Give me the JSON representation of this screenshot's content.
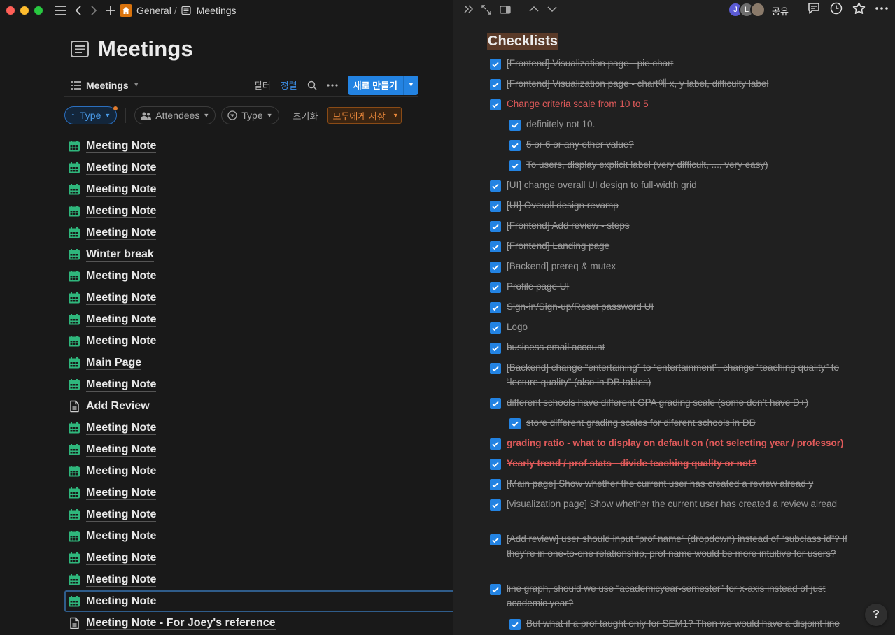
{
  "breadcrumb": {
    "workspace": "General",
    "separator": "/",
    "page": "Meetings"
  },
  "page": {
    "title": "Meetings"
  },
  "viewbar": {
    "view_name": "Meetings",
    "filter_label": "필터",
    "sort_label": "정렬",
    "new_label": "새로 만들기"
  },
  "filterbar": {
    "sort_chip": "Type",
    "attendees_chip": "Attendees",
    "type_chip": "Type",
    "reset_label": "초기화",
    "save_all_label": "모두에게 저장"
  },
  "rows": [
    {
      "title": "Meeting Note",
      "icon": "calendar-icon"
    },
    {
      "title": "Meeting Note",
      "icon": "calendar-icon"
    },
    {
      "title": "Meeting Note",
      "icon": "calendar-icon"
    },
    {
      "title": "Meeting Note",
      "icon": "calendar-icon"
    },
    {
      "title": "Meeting Note",
      "icon": "calendar-icon"
    },
    {
      "title": "Winter break",
      "icon": "calendar-icon"
    },
    {
      "title": "Meeting Note",
      "icon": "calendar-icon"
    },
    {
      "title": "Meeting Note",
      "icon": "calendar-icon"
    },
    {
      "title": "Meeting Note",
      "icon": "calendar-icon"
    },
    {
      "title": "Meeting Note",
      "icon": "calendar-icon"
    },
    {
      "title": "Main Page",
      "icon": "calendar-icon"
    },
    {
      "title": "Meeting Note",
      "icon": "calendar-icon"
    },
    {
      "title": "Add Review",
      "icon": "page-icon"
    },
    {
      "title": "Meeting Note",
      "icon": "calendar-icon"
    },
    {
      "title": "Meeting Note",
      "icon": "calendar-icon"
    },
    {
      "title": "Meeting Note",
      "icon": "calendar-icon"
    },
    {
      "title": "Meeting Note",
      "icon": "calendar-icon"
    },
    {
      "title": "Meeting Note",
      "icon": "calendar-icon"
    },
    {
      "title": "Meeting Note",
      "icon": "calendar-icon"
    },
    {
      "title": "Meeting Note",
      "icon": "calendar-icon"
    },
    {
      "title": "Meeting Note",
      "icon": "calendar-icon"
    },
    {
      "title": "Meeting Note",
      "icon": "calendar-icon",
      "selected": true
    },
    {
      "title": "Meeting Note - For Joey's reference",
      "icon": "page-icon"
    }
  ],
  "right_panel": {
    "avatars": [
      "J",
      "L",
      ""
    ],
    "share_label": "공유",
    "section_title": "Checklists",
    "help_label": "?",
    "checklist": [
      {
        "text": "[Frontend] Visualization page - pie chart",
        "indent": 0,
        "lines": 1
      },
      {
        "text": "[Frontend] Visualization page - chart에 x, y label,  difficulty label",
        "indent": 0,
        "lines": 1
      },
      {
        "text": "Change criteria scale from 10 to 5",
        "indent": 0,
        "lines": 1,
        "style": "red"
      },
      {
        "text": "definitely not 10.",
        "indent": 1,
        "lines": 1
      },
      {
        "text": "5 or 6 or any other value?",
        "indent": 1,
        "lines": 1
      },
      {
        "text": "To users, display explicit label (very difficult, ..., very easy)",
        "indent": 1,
        "lines": 1
      },
      {
        "text": "[UI] change overall UI design to full-width grid",
        "indent": 0,
        "lines": 1
      },
      {
        "text": "[UI] Overall design revamp",
        "indent": 0,
        "lines": 1
      },
      {
        "text": "[Frontend] Add review - steps",
        "indent": 0,
        "lines": 1
      },
      {
        "text": "[Frontend] Landing page",
        "indent": 0,
        "lines": 1
      },
      {
        "text": "[Backend] prereq & mutex",
        "indent": 0,
        "lines": 1
      },
      {
        "text": "Profile page UI",
        "indent": 0,
        "lines": 1
      },
      {
        "text": "Sign-in/Sign-up/Reset password UI",
        "indent": 0,
        "lines": 1
      },
      {
        "text": "Logo",
        "indent": 0,
        "lines": 1
      },
      {
        "text": "business email account",
        "indent": 0,
        "lines": 1
      },
      {
        "text": "[Backend] change “entertaining” to “entertainment”, change “teaching quality” to “lecture quality” (also in DB tables)",
        "indent": 0,
        "lines": 2
      },
      {
        "text": "different schools have different GPA grading scale (some don’t have D+)",
        "indent": 0,
        "lines": 1
      },
      {
        "text": "store different grading scales for diferent schools in DB",
        "indent": 1,
        "lines": 1
      },
      {
        "text": "grading ratio - what to display on default on (not selecting year / professor)",
        "indent": 0,
        "lines": 1,
        "style": "red-bold"
      },
      {
        "text": "Yearly trend / prof stats - divide teaching quality or not?",
        "indent": 0,
        "lines": 1,
        "style": "red-bold"
      },
      {
        "text": "[Main page] Show whether the current user has created a review alread y",
        "indent": 0,
        "lines": 1
      },
      {
        "text": " [visualization page]  Show whether the current user has created a review alread ",
        "indent": 0,
        "lines": 2
      },
      {
        "text": "[Add review] user should input “prof name” (dropdown) instead of “subclass id”? If they’re in one-to-one relationship, prof name would be more intuitive for users?",
        "indent": 0,
        "lines": 3
      },
      {
        "text": "line graph, should we use “academicyear-semester” for x-axis instead of just academic year?",
        "indent": 0,
        "lines": 2
      },
      {
        "text": "But what if a prof taught only for SEM1? Then we would have a disjoint line",
        "indent": 1,
        "lines": 1
      }
    ]
  },
  "colors": {
    "accent": "#2383e2",
    "calendar_icon": "#2fb67c",
    "struck_red": "#e05a5a",
    "save_orange": "#e8873a"
  }
}
